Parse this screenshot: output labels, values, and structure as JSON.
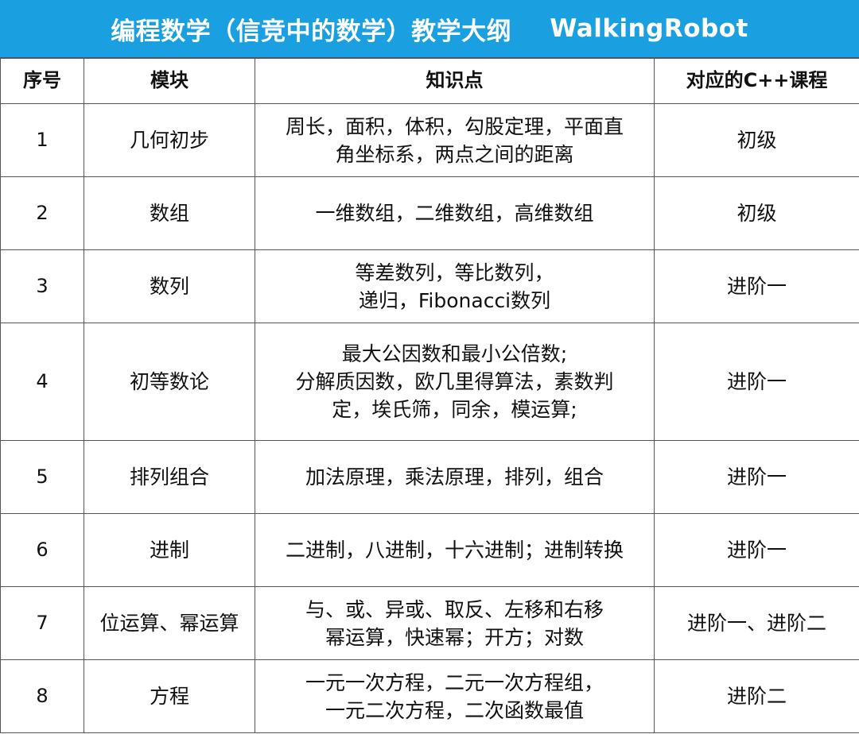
{
  "title": {
    "main": "编程数学（信竞中的数学）教学大纲",
    "brand": "WalkingRobot"
  },
  "header": [
    "序号",
    "模块",
    "知识点",
    "对应的C++课程"
  ],
  "rows": [
    {
      "no": "1",
      "module": "几何初步",
      "knowledge": "周长，面积，体积，勾股定理，平面直\n角坐标系，两点之间的距离",
      "course": "初级"
    },
    {
      "no": "2",
      "module": "数组",
      "knowledge": "一维数组，二维数组，高维数组",
      "course": "初级"
    },
    {
      "no": "3",
      "module": "数列",
      "knowledge": "等差数列，等比数列，\n递归，Fibonacci数列",
      "course": "进阶一"
    },
    {
      "no": "4",
      "module": "初等数论",
      "knowledge": "最大公因数和最小公倍数;\n分解质因数，欧几里得算法，素数判\n定，埃氏筛，同余，模运算;",
      "course": "进阶一"
    },
    {
      "no": "5",
      "module": "排列组合",
      "knowledge": "加法原理，乘法原理，排列，组合",
      "course": "进阶一"
    },
    {
      "no": "6",
      "module": "进制",
      "knowledge": "二进制，八进制，十六进制；进制转换",
      "course": "进阶一"
    },
    {
      "no": "7",
      "module": "位运算、幂运算",
      "knowledge": "与、或、异或、取反、左移和右移\n幂运算，快速幂；开方；对数",
      "course": "进阶一、进阶二"
    },
    {
      "no": "8",
      "module": "方程",
      "knowledge": "一元一次方程，二元一次方程组，\n一元二次方程，二次函数最值",
      "course": "进阶二"
    }
  ]
}
